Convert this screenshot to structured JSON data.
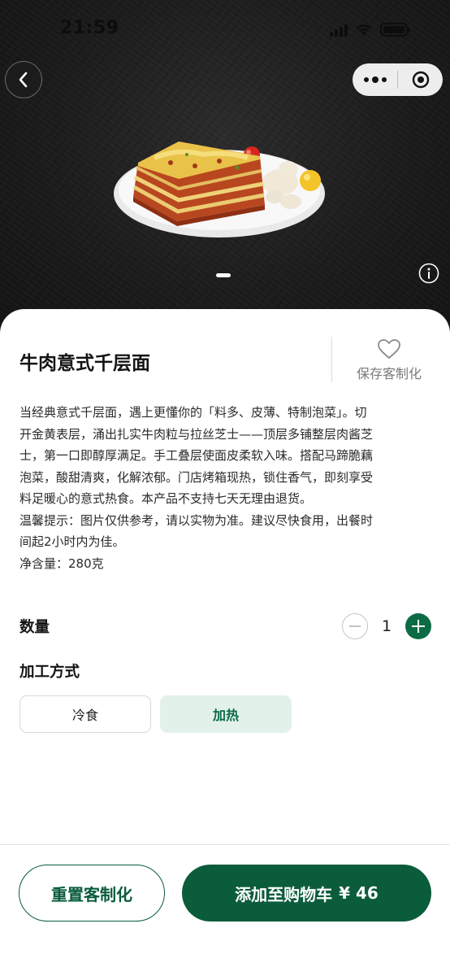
{
  "status_bar": {
    "time": "21:59"
  },
  "hero": {
    "image_icon": "lasagna-plate-image",
    "carousel_index": 1,
    "carousel_total": 1
  },
  "product": {
    "title": "牛肉意式千层面",
    "save_label": "保存客制化",
    "description": [
      "当经典意式千层面，遇上更懂你的「料多、皮薄、特制泡菜」。切",
      "开金黄表层，涌出扎实牛肉粒与拉丝芝士——顶层多铺整层肉酱芝",
      "士，第一口即醇厚满足。手工叠层使面皮柔软入味。搭配马蹄脆藕",
      "泡菜，酸甜清爽，化解浓郁。门店烤箱现热，锁住香气，即刻享受",
      "料足暖心的意式热食。本产品不支持七天无理由退货。",
      "温馨提示：图片仅供参考，请以实物为准。建议尽快食用，出餐时",
      "间起2小时内为佳。",
      "净含量：280克"
    ]
  },
  "quantity": {
    "label": "数量",
    "value": "1"
  },
  "processing": {
    "label": "加工方式",
    "options": [
      "冷食",
      "加热"
    ],
    "selected": "加热"
  },
  "actions": {
    "reset_label": "重置客制化",
    "add_label": "添加至购物车",
    "price": "¥ 46"
  },
  "colors": {
    "brand_green": "#0b5c3b",
    "selected_bg": "#e2f2ea"
  }
}
